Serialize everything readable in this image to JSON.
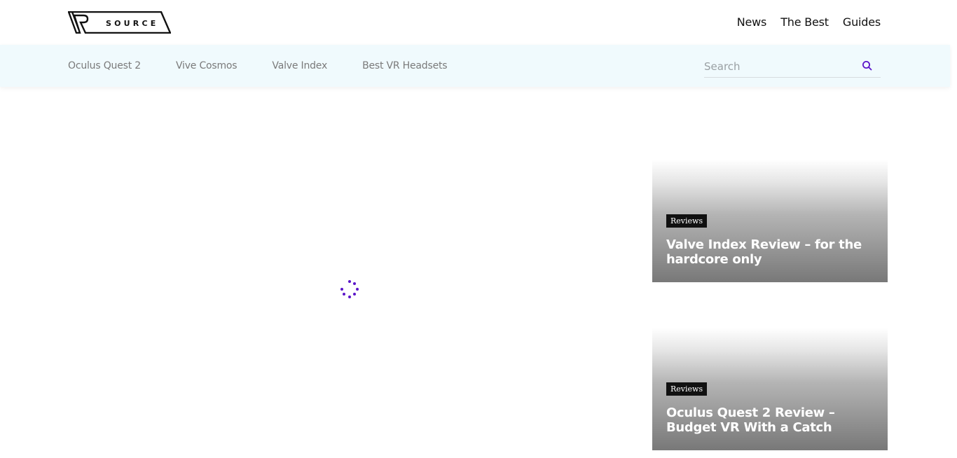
{
  "header": {
    "logo_text": "VR SOURCE",
    "nav": [
      "News",
      "The Best",
      "Guides"
    ]
  },
  "subnav": {
    "items": [
      "Oculus Quest 2",
      "Vive Cosmos",
      "Valve Index",
      "Best VR Headsets"
    ],
    "search_placeholder": "Search",
    "search_value": ""
  },
  "loading": {
    "icon": "loading-spinner-icon",
    "color": "#5b16c9"
  },
  "cards": [
    {
      "category": "Reviews",
      "title": "Valve Index Review – for the hardcore only"
    },
    {
      "category": "Reviews",
      "title": "Oculus Quest 2 Review – Budget VR With a Catch"
    }
  ],
  "colors": {
    "accent": "#5b16c9",
    "subnav_bg": "#f0fafd",
    "badge_bg": "#111111"
  }
}
